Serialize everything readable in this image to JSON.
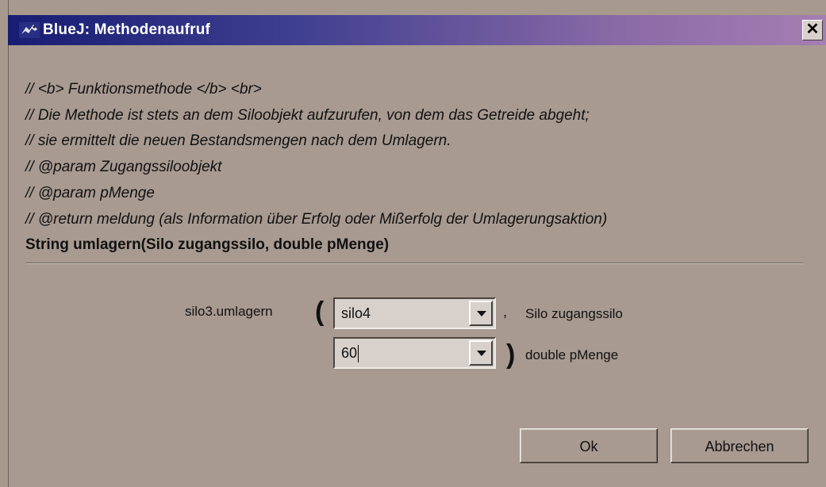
{
  "window": {
    "title": "BlueJ:  Methodenaufruf",
    "close_glyph": "✕",
    "icon": "bluej-bird-icon"
  },
  "comments": [
    "// <b> Funktionsmethode </b> <br>",
    "// Die Methode ist stets an dem Siloobjekt aufzurufen, von dem das Getreide abgeht;",
    "// sie ermittelt die neuen Bestandsmengen nach dem Umlagern.",
    "// @param Zugangssiloobjekt",
    "// @param pMenge",
    "// @return meldung (als Information über Erfolg oder Mißerfolg der Umlagerungsaktion)"
  ],
  "signature": "String umlagern(Silo zugangssilo, double pMenge)",
  "call": {
    "target": "silo3.umlagern",
    "open_paren": "(",
    "close_paren": ")",
    "comma": ",",
    "params": [
      {
        "value": "silo4",
        "type_label": "Silo zugangssilo"
      },
      {
        "value": "60",
        "type_label": "double pMenge"
      }
    ]
  },
  "buttons": {
    "ok": "Ok",
    "cancel": "Abbrechen"
  }
}
